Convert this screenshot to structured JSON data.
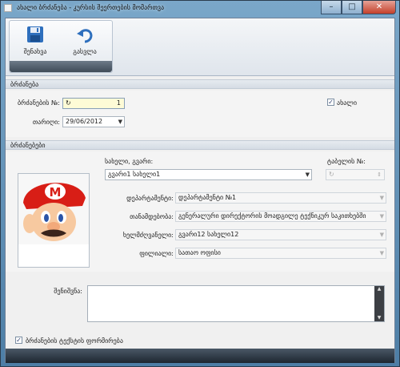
{
  "window": {
    "title": "ახალი ბრძანება - კურსის შეერთების მომართვა"
  },
  "ribbon": {
    "save_label": "შენახვა",
    "exit_label": "გასვლა"
  },
  "order_section": {
    "header": "ბრძანება",
    "number_label": "ბრძანების №:",
    "number_value": "1",
    "date_label": "თარიღი:",
    "date_value": "29/06/2012",
    "new_checkbox_label": "ახალი",
    "new_checked": true
  },
  "orders_section": {
    "header": "ბრძანებები",
    "name_label": "სახელი, გვარი:",
    "name_value": "გვარი1 სახელი1",
    "tabel_label": "ტაბელის №:",
    "department_label": "დეპარტამენტი:",
    "department_value": "დეპარტამენტი №1",
    "position_label": "თანამდებობა:",
    "position_value": "გენერალური დირექტორის მოადგილე ტექნიკურ საკითხებში",
    "manager_label": "ხელმძღვანელი:",
    "manager_value": "გვარი12 სახელი12",
    "branch_label": "ფილიალი:",
    "branch_value": "სათაო ოფისი"
  },
  "notes": {
    "label": "შენიშვნა:",
    "value": ""
  },
  "footer": {
    "checkbox_label": "ბრძანების ტექსტის ფორმირება",
    "checked": true
  },
  "colors": {
    "ribbon_icon_blue": "#2e6fbd",
    "highlight_yellow": "#fefbd6",
    "titlebar_blue": "#5f8fb8"
  }
}
